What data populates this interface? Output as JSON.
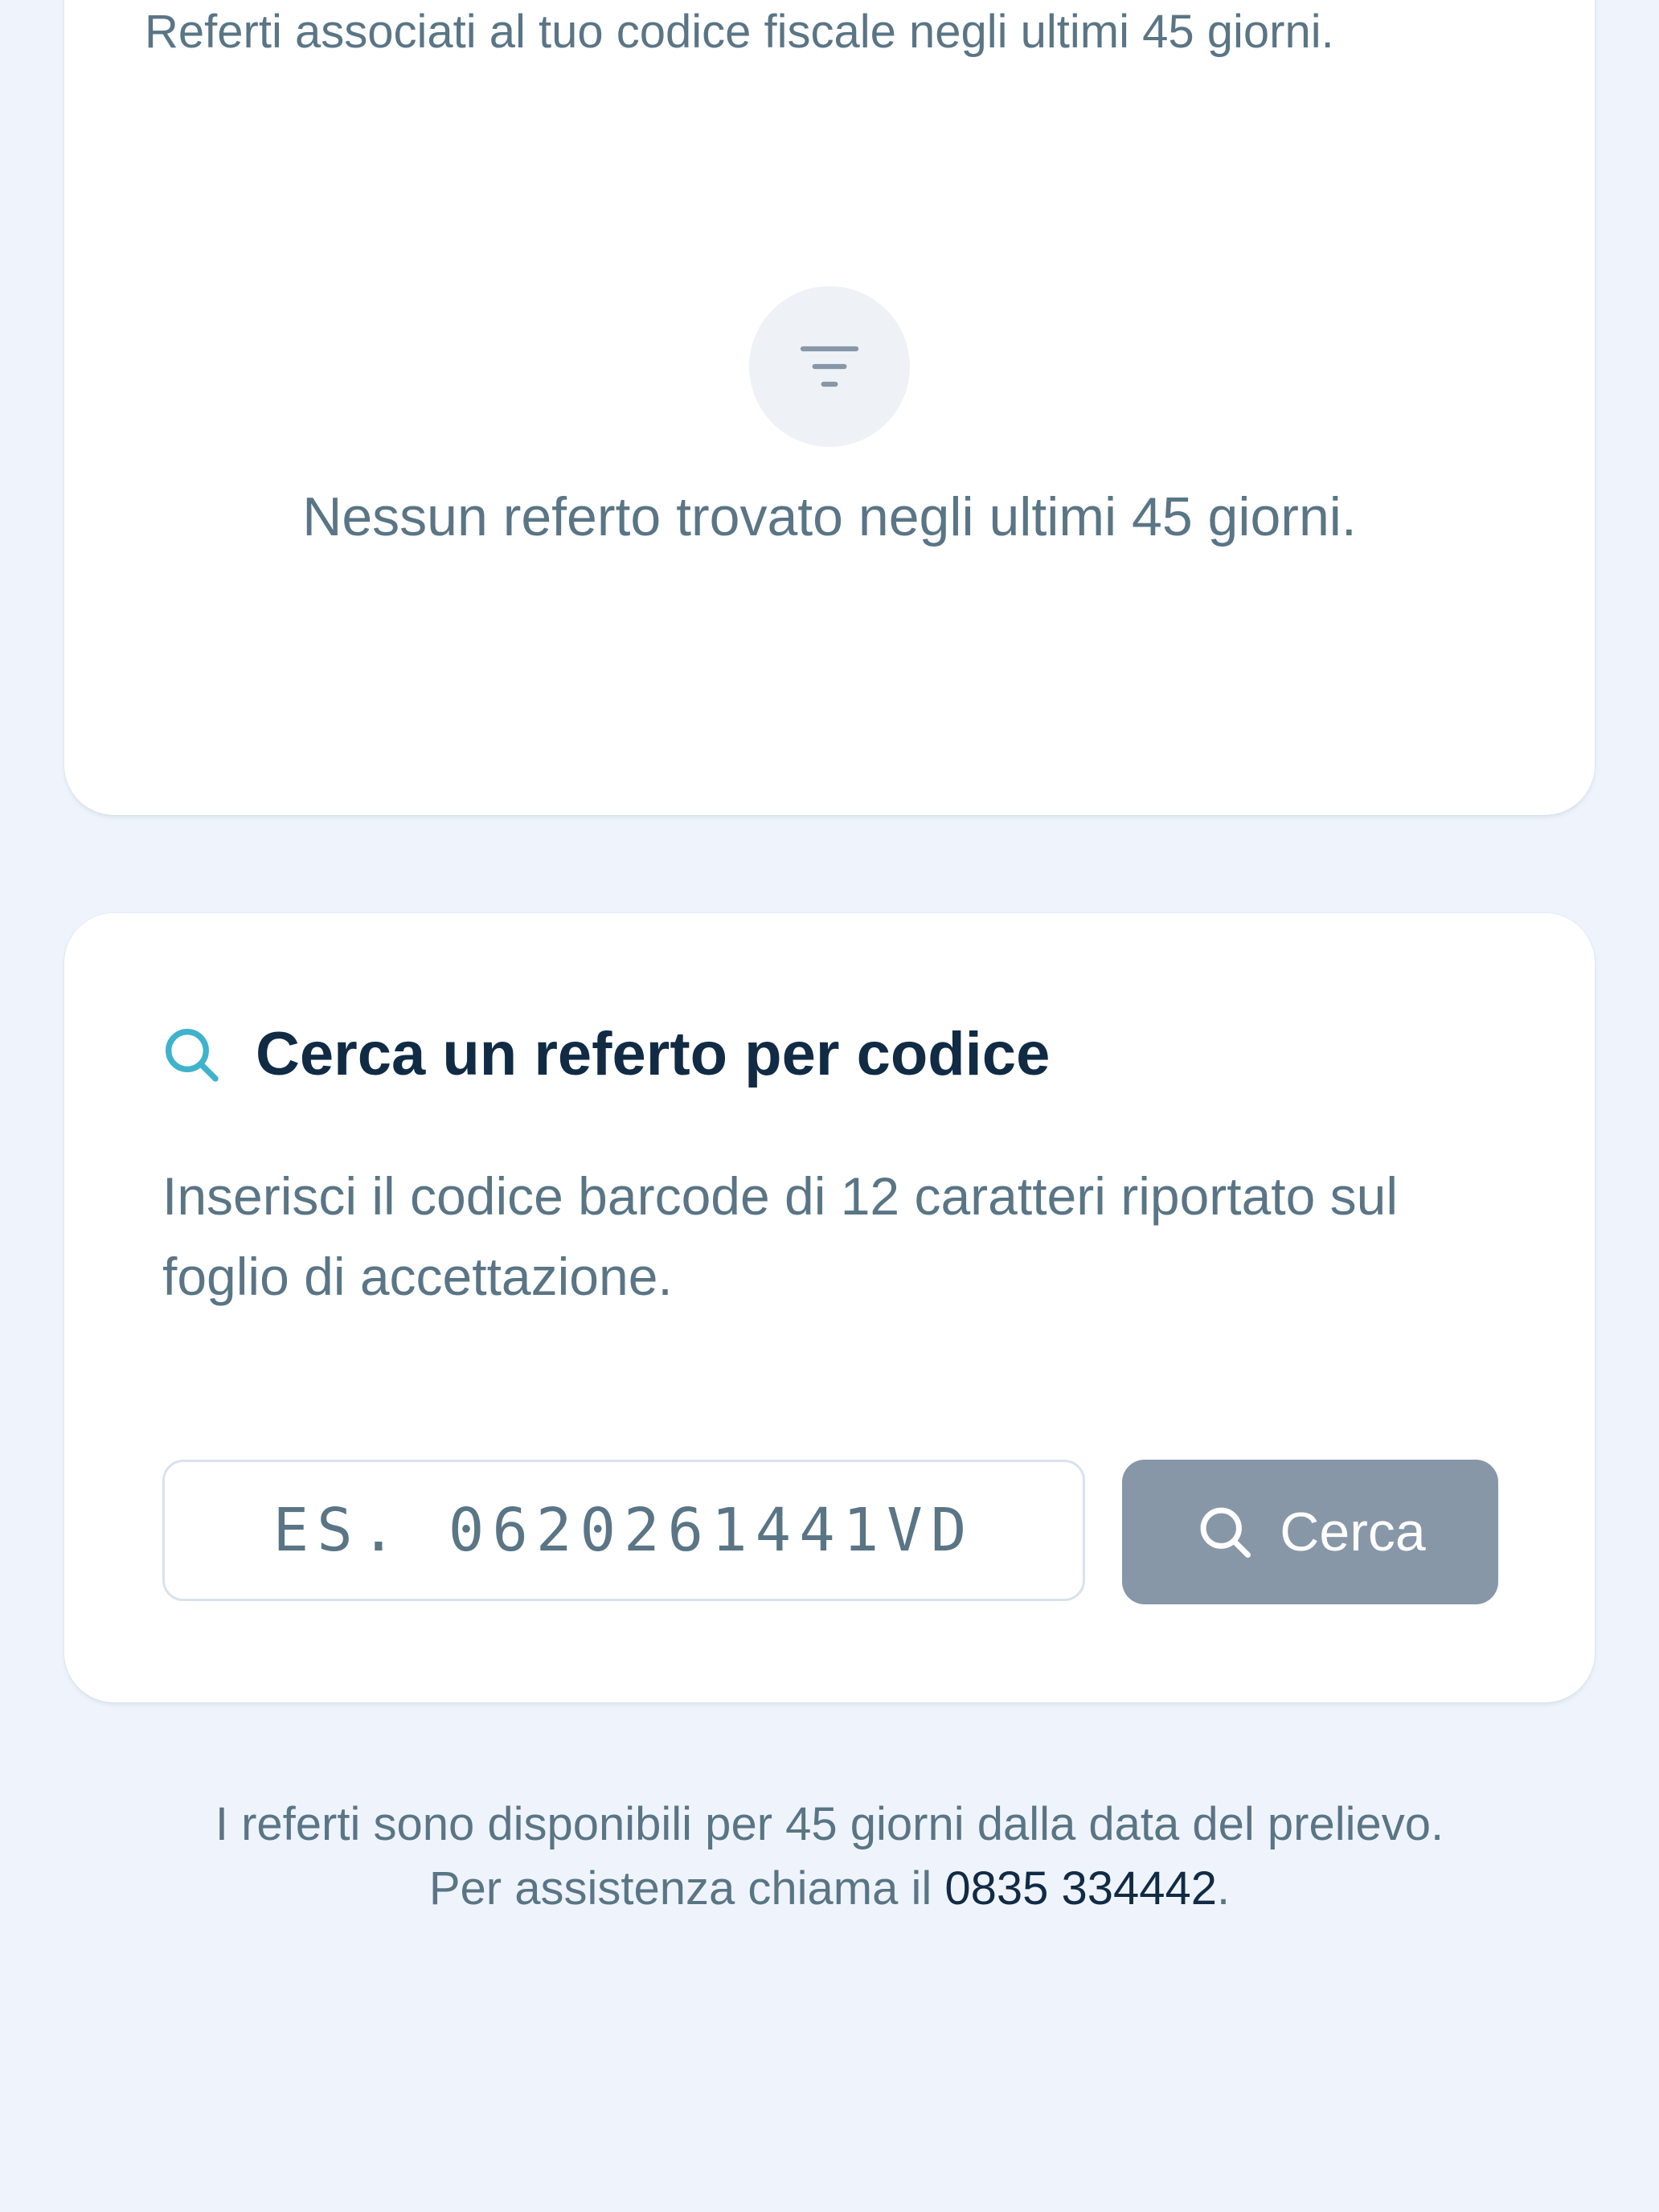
{
  "reports": {
    "subtitle": "Referti associati al tuo codice fiscale negli ultimi 45 giorni.",
    "empty_icon": "filter-icon",
    "empty_message": "Nessun referto trovato negli ultimi 45 giorni."
  },
  "search": {
    "icon": "search-icon",
    "title": "Cerca un referto per codice",
    "description": "Inserisci il codice barcode di 12 caratteri riportato sul foglio di accettazione.",
    "input_value": "",
    "input_placeholder": "ES. 0620261441VD",
    "button_icon": "search-icon",
    "button_label": "Cerca"
  },
  "footer": {
    "line1": "I referti sono disponibili per 45 giorni dalla data del prelievo.",
    "line2_prefix": "Per assistenza chiama il ",
    "phone": "0835 334442",
    "line2_suffix": "."
  },
  "colors": {
    "background": "#eff4fc",
    "card": "#ffffff",
    "accent_icon": "#3fb2cc",
    "title_text": "#112b45",
    "body_text": "#5a7585",
    "button": "#8797a8"
  }
}
